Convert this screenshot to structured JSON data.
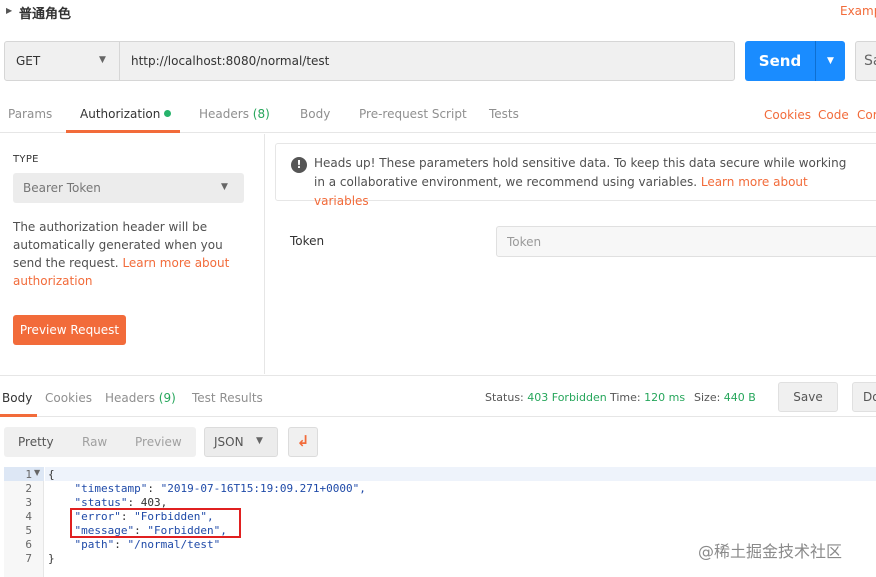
{
  "request": {
    "name": "普通角色",
    "examples_label": "Examp",
    "method": "GET",
    "url": "http://localhost:8080/normal/test",
    "send_label": "Send",
    "save_label": "Sa"
  },
  "tabs": {
    "params": "Params",
    "authorization": "Authorization",
    "headers": "Headers",
    "headers_count": "(8)",
    "body": "Body",
    "prerequest": "Pre-request Script",
    "tests": "Tests",
    "cookies": "Cookies",
    "code": "Code",
    "comments": "Cor"
  },
  "auth": {
    "type_label": "TYPE",
    "type_value": "Bearer Token",
    "desc": "The authorization header will be automatically generated when you send the request. ",
    "desc_link": "Learn more about authorization",
    "preview_button": "Preview Request",
    "notice": "Heads up! These parameters hold sensitive data. To keep this data secure while working in a collaborative environment, we recommend using variables. ",
    "notice_link": "Learn more about variables",
    "token_label": "Token",
    "token_placeholder": "Token"
  },
  "response": {
    "tabs": {
      "body": "Body",
      "cookies": "Cookies",
      "headers": "Headers",
      "headers_count": "(9)",
      "test_results": "Test Results"
    },
    "status_label": "Status:",
    "status_value": "403 Forbidden",
    "time_label": "Time:",
    "time_value": "120 ms",
    "size_label": "Size:",
    "size_value": "440 B",
    "save_label": "Save",
    "download_label": "Do",
    "formats": {
      "pretty": "Pretty",
      "raw": "Raw",
      "preview": "Preview",
      "selected": "JSON"
    },
    "lines": [
      {
        "n": "1",
        "text": "{"
      },
      {
        "n": "2",
        "key": "\"timestamp\"",
        "value": "\"2019-07-16T15:19:09.271+0000\","
      },
      {
        "n": "3",
        "key": "\"status\"",
        "value": "403,"
      },
      {
        "n": "4",
        "key": "\"error\"",
        "value": "\"Forbidden\","
      },
      {
        "n": "5",
        "key": "\"message\"",
        "value": "\"Forbidden\","
      },
      {
        "n": "6",
        "key": "\"path\"",
        "value": "\"/normal/test\""
      },
      {
        "n": "7",
        "text": "}"
      }
    ]
  },
  "watermark": "@稀土掘金技术社区",
  "colors": {
    "accent": "#f26b3a",
    "send": "#1a8cff",
    "success": "#26a65b"
  }
}
